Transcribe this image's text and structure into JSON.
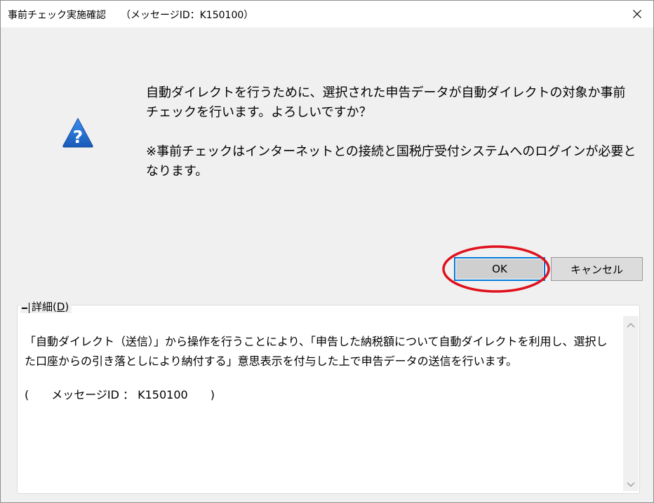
{
  "window": {
    "title": "事前チェック実施確認　　（メッセージID：K150100）"
  },
  "icons": {
    "question": "question-icon",
    "close": "close-icon"
  },
  "message": {
    "line1": "自動ダイレクトを行うために、選択された申告データが自動ダイレクトの対象か事前チェックを行います。よろしいですか？",
    "line2": "※事前チェックはインターネットとの接続と国税庁受付システムへのログインが必要となります。"
  },
  "buttons": {
    "ok_label": "OK",
    "cancel_label": "キャンセル"
  },
  "details": {
    "toggle_symbol": "−",
    "label_prefix": "詳細(",
    "label_key": "D",
    "label_suffix": ")",
    "text1": "「自動ダイレクト（送信）」から操作を行うことにより、「申告した納税額について自動ダイレクトを利用し、選択した口座からの引き落としにより納付する」意思表示を付与した上で申告データの送信を行います。",
    "text2": "(　　メッセージID ： K150100　　)"
  },
  "colors": {
    "highlight": "#e0101c",
    "icon_blue": "#1e6fd0",
    "focus_border": "#0078d7"
  }
}
